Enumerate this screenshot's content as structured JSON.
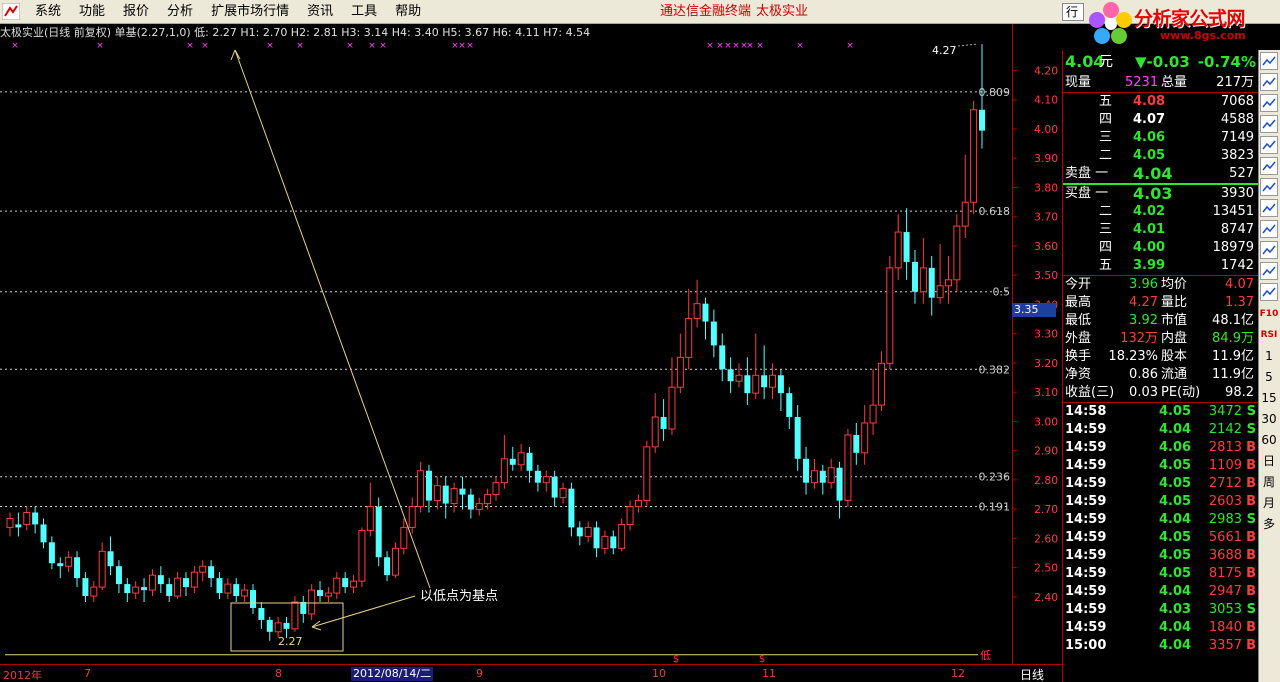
{
  "menu": {
    "items": [
      "系统",
      "功能",
      "报价",
      "分析",
      "扩展市场行情",
      "资讯",
      "工具",
      "帮助"
    ],
    "brand": "通达信金融终端",
    "company": "太极实业",
    "right_tab": "行"
  },
  "watermark": {
    "text": "分析家公式网",
    "url": "www.8gs.com"
  },
  "chart_info": {
    "title": "太极实业(日线 前复权) 单基(2.27,1,0)",
    "values": "低: 2.27  H1: 2.70  H2: 2.81  H3: 3.14  H4: 3.40  H5: 3.67  H6: 4.11  H7: 4.54"
  },
  "chart_data": {
    "type": "candlestick",
    "ylim": [
      2.3,
      4.3
    ],
    "y_ticks": [
      "4.20",
      "4.10",
      "4.00",
      "3.90",
      "3.80",
      "3.70",
      "3.60",
      "3.50",
      "3.40",
      "3.30",
      "3.20",
      "3.10",
      "3.00",
      "2.90",
      "2.80",
      "2.70",
      "2.60",
      "2.50",
      "2.40"
    ],
    "x_labels": [
      "2012年",
      "7",
      "8",
      "9",
      "10",
      "11",
      "12"
    ],
    "x_date_box": "2012/08/14/二",
    "fib_levels": [
      {
        "label": "0.809",
        "y": 4.11
      },
      {
        "label": "0.618",
        "y": 3.71
      },
      {
        "label": "0.5",
        "y": 3.44
      },
      {
        "label": "0.382",
        "y": 3.18
      },
      {
        "label": "0.236",
        "y": 2.82
      },
      {
        "label": "0.191",
        "y": 2.72
      }
    ],
    "base_line": {
      "label": "低",
      "y": 2.27
    },
    "annotation": "以低点为基点",
    "low_label": "2.27",
    "high_label": "4.27",
    "current_price_marker": "3.35",
    "candles": [
      [
        2.65,
        2.68,
        2.62,
        2.7
      ],
      [
        2.66,
        2.65,
        2.62,
        2.7
      ],
      [
        2.66,
        2.7,
        2.64,
        2.72
      ],
      [
        2.7,
        2.66,
        2.63,
        2.72
      ],
      [
        2.66,
        2.6,
        2.58,
        2.68
      ],
      [
        2.6,
        2.53,
        2.51,
        2.62
      ],
      [
        2.53,
        2.52,
        2.48,
        2.55
      ],
      [
        2.52,
        2.55,
        2.5,
        2.57
      ],
      [
        2.55,
        2.48,
        2.45,
        2.57
      ],
      [
        2.48,
        2.42,
        2.4,
        2.5
      ],
      [
        2.42,
        2.45,
        2.4,
        2.47
      ],
      [
        2.45,
        2.57,
        2.44,
        2.6
      ],
      [
        2.57,
        2.52,
        2.49,
        2.62
      ],
      [
        2.52,
        2.46,
        2.43,
        2.54
      ],
      [
        2.46,
        2.43,
        2.4,
        2.48
      ],
      [
        2.43,
        2.45,
        2.41,
        2.47
      ],
      [
        2.45,
        2.44,
        2.4,
        2.48
      ],
      [
        2.44,
        2.49,
        2.42,
        2.51
      ],
      [
        2.49,
        2.46,
        2.43,
        2.52
      ],
      [
        2.46,
        2.42,
        2.4,
        2.48
      ],
      [
        2.42,
        2.48,
        2.41,
        2.5
      ],
      [
        2.48,
        2.45,
        2.42,
        2.5
      ],
      [
        2.45,
        2.5,
        2.43,
        2.52
      ],
      [
        2.5,
        2.52,
        2.47,
        2.54
      ],
      [
        2.52,
        2.48,
        2.45,
        2.54
      ],
      [
        2.48,
        2.43,
        2.41,
        2.5
      ],
      [
        2.43,
        2.46,
        2.41,
        2.48
      ],
      [
        2.46,
        2.42,
        2.4,
        2.48
      ],
      [
        2.42,
        2.44,
        2.4,
        2.46
      ],
      [
        2.44,
        2.38,
        2.36,
        2.46
      ],
      [
        2.38,
        2.34,
        2.31,
        2.4
      ],
      [
        2.34,
        2.3,
        2.27,
        2.35
      ],
      [
        2.3,
        2.33,
        2.28,
        2.35
      ],
      [
        2.33,
        2.31,
        2.28,
        2.35
      ],
      [
        2.31,
        2.4,
        2.3,
        2.42
      ],
      [
        2.4,
        2.36,
        2.33,
        2.42
      ],
      [
        2.36,
        2.44,
        2.34,
        2.46
      ],
      [
        2.44,
        2.42,
        2.4,
        2.47
      ],
      [
        2.42,
        2.43,
        2.4,
        2.45
      ],
      [
        2.43,
        2.48,
        2.41,
        2.5
      ],
      [
        2.48,
        2.45,
        2.43,
        2.5
      ],
      [
        2.45,
        2.47,
        2.43,
        2.49
      ],
      [
        2.47,
        2.64,
        2.45,
        2.65
      ],
      [
        2.64,
        2.72,
        2.62,
        2.8
      ],
      [
        2.72,
        2.55,
        2.52,
        2.75
      ],
      [
        2.55,
        2.49,
        2.47,
        2.57
      ],
      [
        2.49,
        2.58,
        2.48,
        2.6
      ],
      [
        2.58,
        2.65,
        2.56,
        2.68
      ],
      [
        2.65,
        2.72,
        2.63,
        2.75
      ],
      [
        2.72,
        2.84,
        2.7,
        2.87
      ],
      [
        2.84,
        2.74,
        2.7,
        2.86
      ],
      [
        2.74,
        2.79,
        2.71,
        2.82
      ],
      [
        2.79,
        2.73,
        2.68,
        2.82
      ],
      [
        2.73,
        2.78,
        2.7,
        2.8
      ],
      [
        2.78,
        2.76,
        2.71,
        2.82
      ],
      [
        2.76,
        2.71,
        2.68,
        2.78
      ],
      [
        2.71,
        2.73,
        2.69,
        2.75
      ],
      [
        2.73,
        2.76,
        2.71,
        2.78
      ],
      [
        2.76,
        2.8,
        2.74,
        2.82
      ],
      [
        2.8,
        2.88,
        2.78,
        2.96
      ],
      [
        2.88,
        2.86,
        2.84,
        2.92
      ],
      [
        2.86,
        2.9,
        2.84,
        2.93
      ],
      [
        2.9,
        2.84,
        2.8,
        2.92
      ],
      [
        2.84,
        2.8,
        2.77,
        2.86
      ],
      [
        2.8,
        2.82,
        2.77,
        2.84
      ],
      [
        2.82,
        2.75,
        2.72,
        2.84
      ],
      [
        2.75,
        2.78,
        2.73,
        2.8
      ],
      [
        2.78,
        2.65,
        2.62,
        2.8
      ],
      [
        2.65,
        2.62,
        2.59,
        2.67
      ],
      [
        2.62,
        2.65,
        2.6,
        2.67
      ],
      [
        2.65,
        2.58,
        2.55,
        2.67
      ],
      [
        2.58,
        2.62,
        2.56,
        2.64
      ],
      [
        2.62,
        2.58,
        2.56,
        2.64
      ],
      [
        2.58,
        2.66,
        2.57,
        2.68
      ],
      [
        2.66,
        2.72,
        2.64,
        2.74
      ],
      [
        2.72,
        2.74,
        2.7,
        2.76
      ],
      [
        2.74,
        2.92,
        2.72,
        2.94
      ],
      [
        2.92,
        3.02,
        2.9,
        3.1
      ],
      [
        3.02,
        2.98,
        2.94,
        3.08
      ],
      [
        2.98,
        3.12,
        2.96,
        3.22
      ],
      [
        3.12,
        3.22,
        3.1,
        3.3
      ],
      [
        3.22,
        3.35,
        3.18,
        3.45
      ],
      [
        3.35,
        3.4,
        3.32,
        3.48
      ],
      [
        3.4,
        3.34,
        3.28,
        3.42
      ],
      [
        3.34,
        3.26,
        3.22,
        3.38
      ],
      [
        3.26,
        3.18,
        3.14,
        3.3
      ],
      [
        3.18,
        3.14,
        3.1,
        3.22
      ],
      [
        3.14,
        3.16,
        3.12,
        3.2
      ],
      [
        3.16,
        3.1,
        3.06,
        3.22
      ],
      [
        3.1,
        3.16,
        3.08,
        3.3
      ],
      [
        3.16,
        3.12,
        3.08,
        3.26
      ],
      [
        3.12,
        3.16,
        3.08,
        3.2
      ],
      [
        3.16,
        3.1,
        3.04,
        3.18
      ],
      [
        3.1,
        3.02,
        2.98,
        3.12
      ],
      [
        3.02,
        2.88,
        2.84,
        3.06
      ],
      [
        2.88,
        2.8,
        2.76,
        2.92
      ],
      [
        2.8,
        2.84,
        2.78,
        2.88
      ],
      [
        2.84,
        2.8,
        2.76,
        2.86
      ],
      [
        2.8,
        2.85,
        2.78,
        2.88
      ],
      [
        2.85,
        2.74,
        2.68,
        2.87
      ],
      [
        2.74,
        2.96,
        2.72,
        2.98
      ],
      [
        2.96,
        2.9,
        2.86,
        3.0
      ],
      [
        2.9,
        3.0,
        2.86,
        3.06
      ],
      [
        3.0,
        3.06,
        2.96,
        3.18
      ],
      [
        3.06,
        3.2,
        3.04,
        3.24
      ],
      [
        3.2,
        3.52,
        3.18,
        3.56
      ],
      [
        3.52,
        3.64,
        3.48,
        3.7
      ],
      [
        3.64,
        3.54,
        3.48,
        3.72
      ],
      [
        3.54,
        3.44,
        3.4,
        3.58
      ],
      [
        3.44,
        3.52,
        3.4,
        3.62
      ],
      [
        3.52,
        3.42,
        3.36,
        3.56
      ],
      [
        3.42,
        3.46,
        3.4,
        3.6
      ],
      [
        3.46,
        3.48,
        3.4,
        3.56
      ],
      [
        3.48,
        3.66,
        3.44,
        3.7
      ],
      [
        3.66,
        3.74,
        3.62,
        3.9
      ],
      [
        3.74,
        4.05,
        3.7,
        4.08
      ],
      [
        4.05,
        3.98,
        3.92,
        4.27
      ]
    ]
  },
  "quote": {
    "price": "4.04",
    "unit": "元",
    "change": "▼-0.03",
    "pct": "-0.74%",
    "cur_vol_label": "现量",
    "cur_vol": "5231",
    "tot_vol_label": "总量",
    "tot_vol": "217万",
    "asks": [
      {
        "label": "五",
        "price": "4.08",
        "vol": "7068",
        "pc": "red"
      },
      {
        "label": "四",
        "price": "4.07",
        "vol": "4588",
        "pc": "wht"
      },
      {
        "label": "三",
        "price": "4.06",
        "vol": "7149",
        "pc": "grn"
      },
      {
        "label": "二",
        "price": "4.05",
        "vol": "3823",
        "pc": "grn"
      },
      {
        "label": "卖盘 一",
        "price": "4.04",
        "vol": "527",
        "pc": "grn"
      }
    ],
    "bids": [
      {
        "label": "买盘 一",
        "price": "4.03",
        "vol": "3930",
        "pc": "grn"
      },
      {
        "label": "二",
        "price": "4.02",
        "vol": "13451",
        "pc": "grn"
      },
      {
        "label": "三",
        "price": "4.01",
        "vol": "8747",
        "pc": "grn"
      },
      {
        "label": "四",
        "price": "4.00",
        "vol": "18979",
        "pc": "grn"
      },
      {
        "label": "五",
        "price": "3.99",
        "vol": "1742",
        "pc": "grn"
      }
    ],
    "stats": [
      {
        "l1": "今开",
        "v1": "3.96",
        "c1": "grn",
        "l2": "均价",
        "v2": "4.07",
        "c2": "red"
      },
      {
        "l1": "最高",
        "v1": "4.27",
        "c1": "red",
        "l2": "量比",
        "v2": "1.37",
        "c2": "red"
      },
      {
        "l1": "最低",
        "v1": "3.92",
        "c1": "grn",
        "l2": "市值",
        "v2": "48.1亿",
        "c2": "wht"
      },
      {
        "l1": "外盘",
        "v1": "132万",
        "c1": "red",
        "l2": "内盘",
        "v2": "84.9万",
        "c2": "grn"
      },
      {
        "l1": "换手",
        "v1": "18.23%",
        "c1": "wht",
        "l2": "股本",
        "v2": "11.9亿",
        "c2": "wht"
      },
      {
        "l1": "净资",
        "v1": "0.86",
        "c1": "wht",
        "l2": "流通",
        "v2": "11.9亿",
        "c2": "wht"
      },
      {
        "l1": "收益(三)",
        "v1": "0.03",
        "c1": "wht",
        "l2": "PE(动)",
        "v2": "98.2",
        "c2": "wht"
      }
    ],
    "ticks": [
      {
        "t": "14:58",
        "p": "4.05",
        "v": "3472",
        "s": "S"
      },
      {
        "t": "14:59",
        "p": "4.04",
        "v": "2142",
        "s": "S"
      },
      {
        "t": "14:59",
        "p": "4.06",
        "v": "2813",
        "s": "B"
      },
      {
        "t": "14:59",
        "p": "4.05",
        "v": "1109",
        "s": "B"
      },
      {
        "t": "14:59",
        "p": "4.05",
        "v": "2712",
        "s": "B"
      },
      {
        "t": "14:59",
        "p": "4.05",
        "v": "2603",
        "s": "B"
      },
      {
        "t": "14:59",
        "p": "4.04",
        "v": "2983",
        "s": "S"
      },
      {
        "t": "14:59",
        "p": "4.05",
        "v": "5661",
        "s": "B"
      },
      {
        "t": "14:59",
        "p": "4.05",
        "v": "3688",
        "s": "B"
      },
      {
        "t": "14:59",
        "p": "4.05",
        "v": "8175",
        "s": "B"
      },
      {
        "t": "14:59",
        "p": "4.04",
        "v": "2947",
        "s": "B"
      },
      {
        "t": "14:59",
        "p": "4.03",
        "v": "3053",
        "s": "S"
      },
      {
        "t": "14:59",
        "p": "4.04",
        "v": "1840",
        "s": "B"
      },
      {
        "t": "15:00",
        "p": "4.04",
        "v": "3357",
        "s": "B"
      }
    ]
  },
  "period_label": "日线",
  "toolbar": [
    "F10",
    "RSI",
    "1",
    "5",
    "15",
    "30",
    "60",
    "日",
    "周",
    "月",
    "多"
  ]
}
